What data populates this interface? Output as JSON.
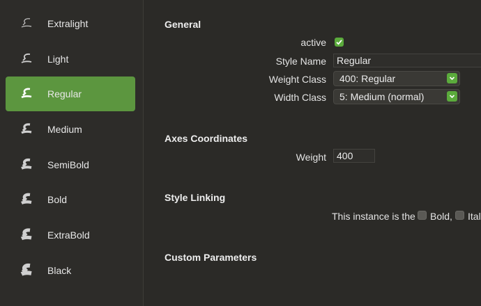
{
  "instances": [
    {
      "label": "Extralight",
      "selected": false
    },
    {
      "label": "Light",
      "selected": false
    },
    {
      "label": "Regular",
      "selected": true
    },
    {
      "label": "Medium",
      "selected": false
    },
    {
      "label": "SemiBold",
      "selected": false
    },
    {
      "label": "Bold",
      "selected": false
    },
    {
      "label": "ExtraBold",
      "selected": false
    },
    {
      "label": "Black",
      "selected": false
    }
  ],
  "general": {
    "title": "General",
    "active_label": "active",
    "active_checked": true,
    "style_name_label": "Style Name",
    "style_name_value": "Regular",
    "weight_class_label": "Weight Class",
    "weight_class_value": "400: Regular",
    "width_class_label": "Width Class",
    "width_class_value": "5: Medium (normal)"
  },
  "axes": {
    "title": "Axes Coordinates",
    "weight_label": "Weight",
    "weight_value": "400"
  },
  "style_linking": {
    "title": "Style Linking",
    "prefix": "This instance is the",
    "bold_label": "Bold,",
    "italic_label": "Ital"
  },
  "custom_parameters": {
    "title": "Custom Parameters"
  },
  "colors": {
    "accent": "#5c963f",
    "check": "#5bab3c",
    "background": "#2b2a27"
  }
}
